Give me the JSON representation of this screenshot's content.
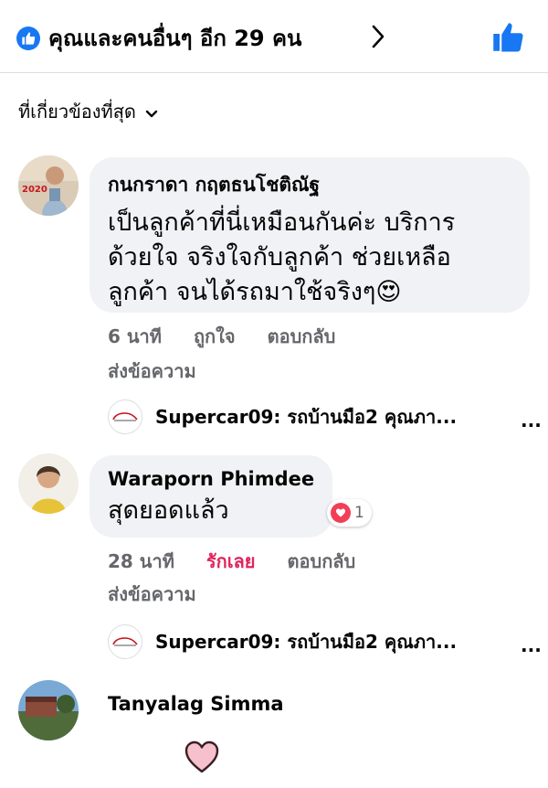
{
  "header": {
    "summary": "คุณและคนอื่นๆ อีก 29 คน",
    "reaction_icon": "like-icon",
    "like_button_icon": "thumbs-up-icon"
  },
  "sort": {
    "label": "ที่เกี่ยวข้องที่สุด"
  },
  "comments": [
    {
      "author": "กนกราดา กฤตธนโชติณัฐ",
      "avatar_caption": "2020",
      "text_lines": [
        "เป็นลูกค้าที่นี่เหมือนกันค่ะ บริการ",
        "ด้วยใจ จริงใจกับลูกค้า ช่วยเหลือ",
        "ลูกค้า จนได้รถมาใช้จริงๆ😍"
      ],
      "time": "6 นาที",
      "action_react": "ถูกใจ",
      "action_reply": "ตอบกลับ",
      "action_message": "ส่งข้อความ",
      "reply_preview": "Supercar09: รถบ้านมือ2 คุณภา...",
      "reply_more": "..."
    },
    {
      "author": "Waraporn Phimdee",
      "text_lines": [
        "สุดยอดแล้ว"
      ],
      "reaction_count": "1",
      "time": "28 นาที",
      "action_react": "รักเลย",
      "action_reply": "ตอบกลับ",
      "action_message": "ส่งข้อความ",
      "reply_preview": "Supercar09: รถบ้านมือ2 คุณภา...",
      "reply_more": "..."
    },
    {
      "author": "Tanyalag Simma",
      "sticker_icon": "heart-sticker-icon"
    }
  ],
  "colors": {
    "accent": "#1877f2",
    "love": "#e0245e",
    "bubble": "#f0f2f5",
    "meta": "#65676b"
  }
}
